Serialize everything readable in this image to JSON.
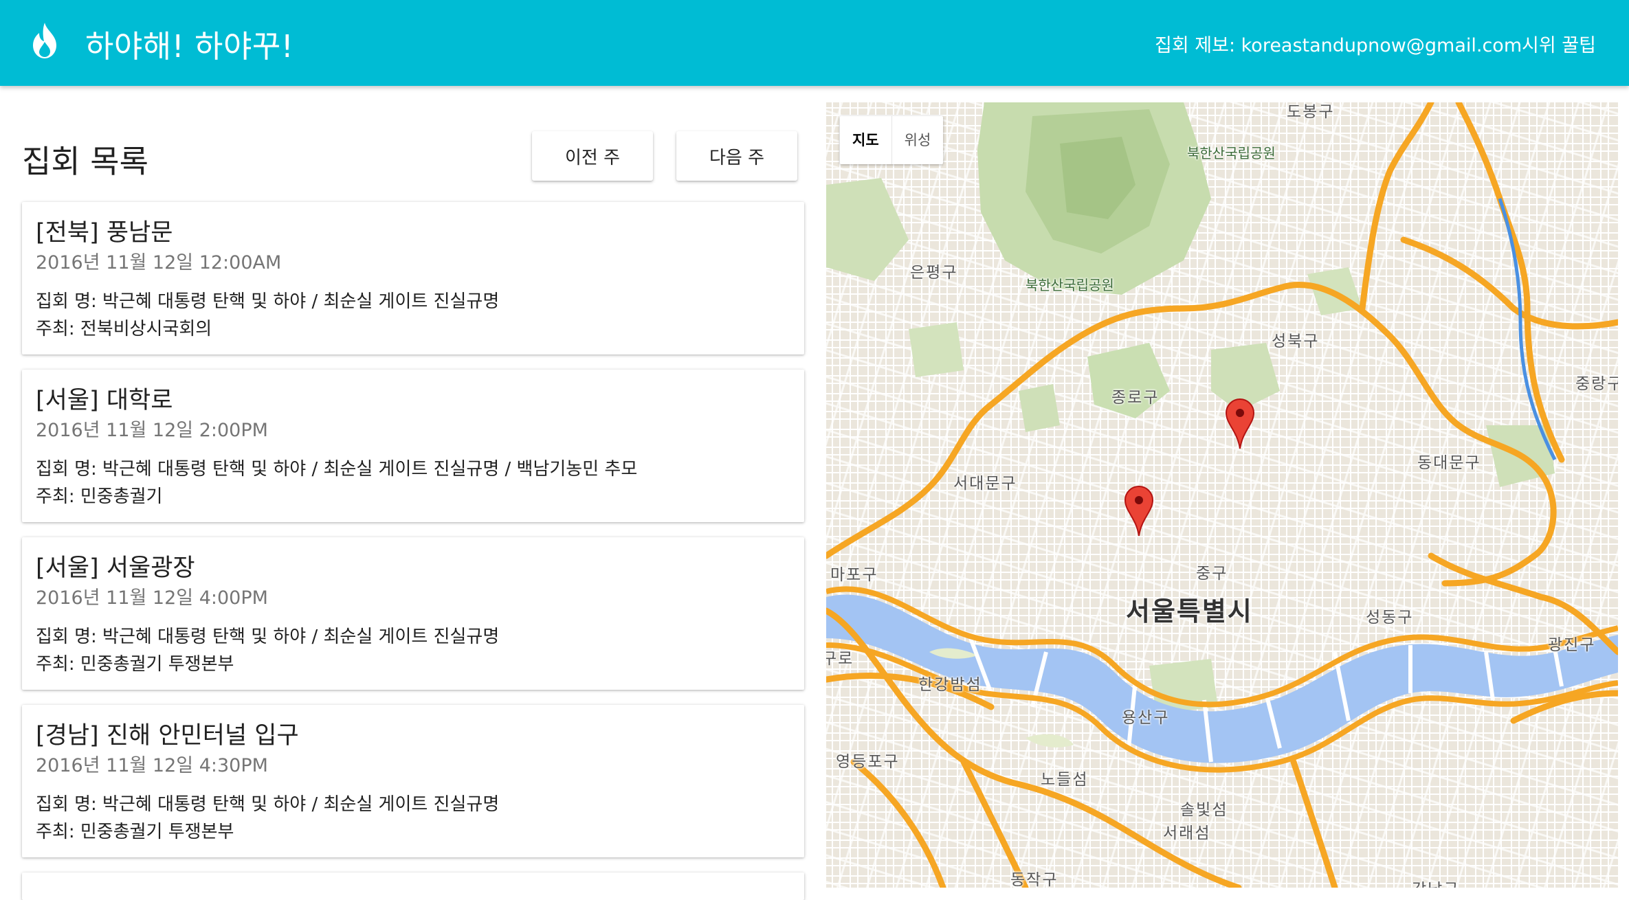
{
  "header": {
    "title": "하야해! 하야꾸!",
    "report_text": "집회 제보: koreastandupnow@gmail.com",
    "tips_link": "시위 꿀팁"
  },
  "list": {
    "heading": "집회 목록",
    "prev_week": "이전 주",
    "next_week": "다음 주",
    "items": [
      {
        "title": "[전북] 풍남문",
        "date": "2016년 11월 12일 12:00AM",
        "name": "집회 명: 박근혜 대통령 탄핵 및 하야 / 최순실 게이트 진실규명",
        "host": "주최: 전북비상시국회의"
      },
      {
        "title": "[서울] 대학로",
        "date": "2016년 11월 12일 2:00PM",
        "name": "집회 명: 박근혜 대통령 탄핵 및 하야 / 최순실 게이트 진실규명 / 백남기농민 추모",
        "host": "주최: 민중총궐기"
      },
      {
        "title": "[서울] 서울광장",
        "date": "2016년 11월 12일 4:00PM",
        "name": "집회 명: 박근혜 대통령 탄핵 및 하야 / 최순실 게이트 진실규명",
        "host": "주최: 민중총궐기 투쟁본부"
      },
      {
        "title": "[경남] 진해 안민터널 입구",
        "date": "2016년 11월 12일 4:30PM",
        "name": "집회 명: 박근혜 대통령 탄핵 및 하야 / 최순실 게이트 진실규명",
        "host": "주최: 민중총궐기 투쟁본부"
      }
    ]
  },
  "map": {
    "type_map": "지도",
    "type_satellite": "위성",
    "city": "서울특별시",
    "labels": {
      "bukhansan_1": "북한산국립공원",
      "bukhansan_2": "북한산국립공원",
      "eunpyeong": "은평구",
      "seongbuk": "성북구",
      "jongno": "종로구",
      "seodaemun": "서대문구",
      "dongdaemun": "동대문구",
      "jungnang": "중랑구",
      "jung": "중구",
      "mapo": "마포구",
      "seongdong": "성동구",
      "gwangjin": "광진구",
      "hangang_bamseom": "한강밤섬",
      "yongsan": "용산구",
      "yeongdeungpo": "영등포구",
      "nodeulseom": "노들섬",
      "solbitseom": "솔빛섬",
      "seorae": "서래섬",
      "dongjak": "동작구",
      "gu_top": "도봉구",
      "gu_left": "구로",
      "gangnam_bottom": "강남구"
    }
  },
  "colors": {
    "primary": "#00bcd4",
    "pin": "#ea4335",
    "river": "#a3c4f3",
    "highway": "#f6a623"
  }
}
